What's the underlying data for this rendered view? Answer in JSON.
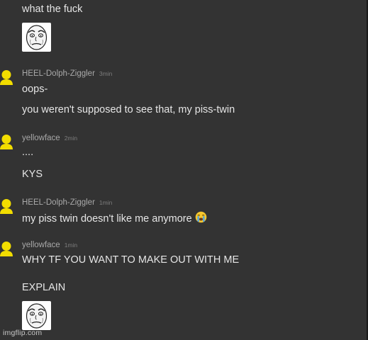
{
  "messages": {
    "m0": {
      "text": "what the fuck"
    },
    "m1": {
      "user": "HEEL-Dolph-Ziggler",
      "time": "3min",
      "line1": "oops-",
      "line2": "you weren't supposed to see that, my piss-twin"
    },
    "m2": {
      "user": "yellowface",
      "time": "2min",
      "line1": "....",
      "line2": "KYS"
    },
    "m3": {
      "user": "HEEL-Dolph-Ziggler",
      "time": "1min",
      "line1": "my piss twin doesn't like me anymore"
    },
    "m4": {
      "user": "yellowface",
      "time": "1min",
      "line1": "WHY TF YOU WANT TO MAKE OUT WITH ME",
      "line2": "EXPLAIN"
    }
  },
  "icons": {
    "avatar": "person-avatar-icon",
    "emoji": "loudly-crying-face-icon",
    "meme": "okay-guy-meme-face-icon"
  },
  "colors": {
    "background": "#333333",
    "text": "#e6e6e6",
    "username": "#a9a9a9",
    "timestamp": "#7d7d7d",
    "avatar": "#f2dd00"
  },
  "watermark": "imgflip.com"
}
